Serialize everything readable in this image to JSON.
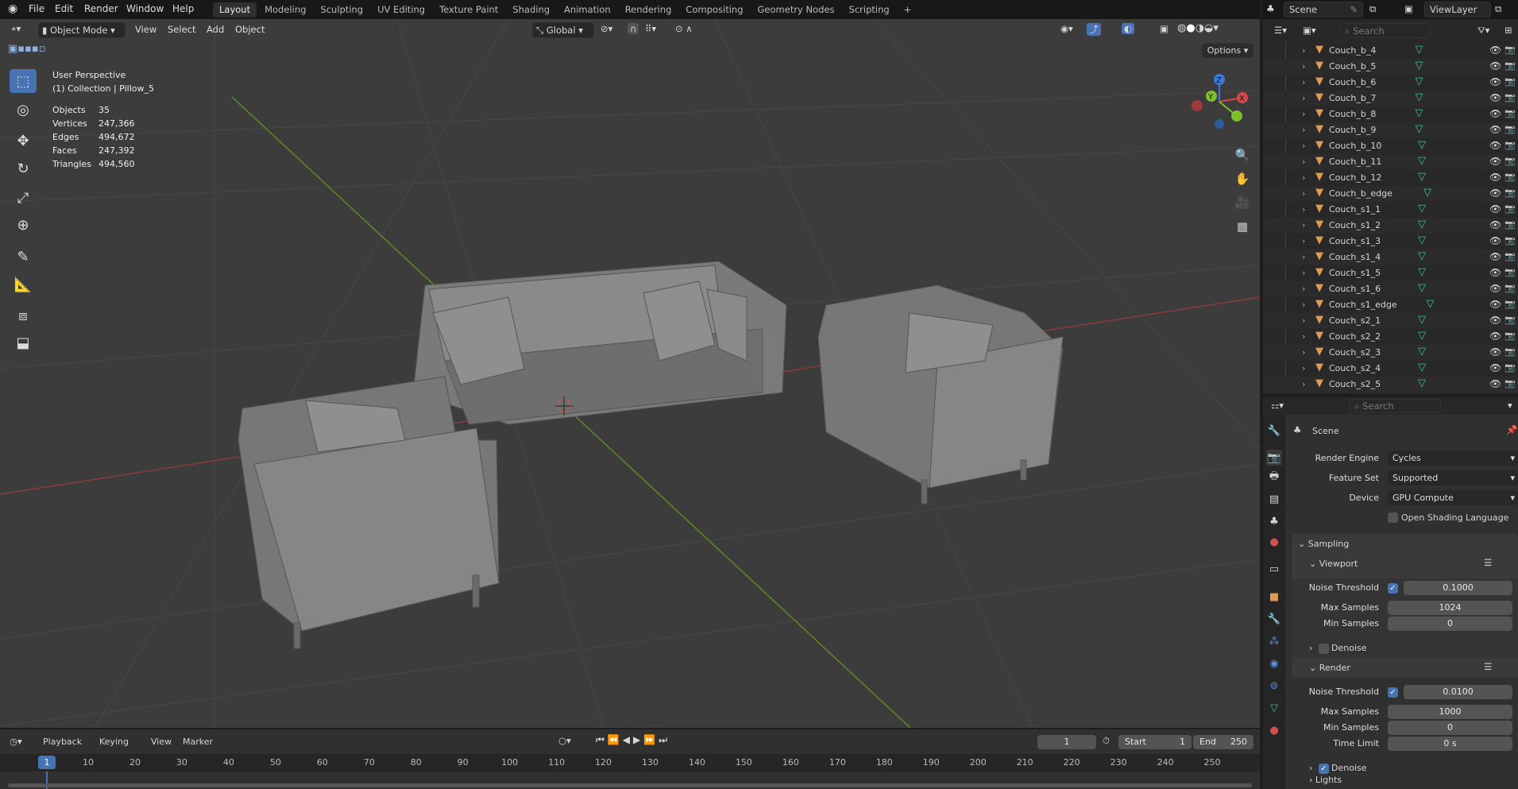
{
  "menu": [
    "File",
    "Edit",
    "Render",
    "Window",
    "Help"
  ],
  "workspaces": [
    "Layout",
    "Modeling",
    "Sculpting",
    "UV Editing",
    "Texture Paint",
    "Shading",
    "Animation",
    "Rendering",
    "Compositing",
    "Geometry Nodes",
    "Scripting",
    "+"
  ],
  "header": {
    "mode": "Object Mode",
    "menus": [
      "View",
      "Select",
      "Add",
      "Object"
    ],
    "transform_orientation": "Global",
    "options": "Options"
  },
  "overlay": {
    "perspective": "User Perspective",
    "collection": "(1) Collection | Pillow_5",
    "stats": [
      {
        "label": "Objects",
        "value": "35"
      },
      {
        "label": "Vertices",
        "value": "247,366"
      },
      {
        "label": "Edges",
        "value": "494,672"
      },
      {
        "label": "Faces",
        "value": "247,392"
      },
      {
        "label": "Triangles",
        "value": "494,560"
      }
    ]
  },
  "gizmo": {
    "x": "X",
    "y": "Y",
    "z": "Z"
  },
  "timeline": {
    "menus": [
      "Playback",
      "Keying",
      "View",
      "Marker"
    ],
    "current_frame": "1",
    "start_label": "Start",
    "start": "1",
    "end_label": "End",
    "end": "250",
    "ticks": [
      "10",
      "20",
      "30",
      "40",
      "50",
      "60",
      "70",
      "80",
      "90",
      "100",
      "110",
      "120",
      "130",
      "140",
      "150",
      "160",
      "170",
      "180",
      "190",
      "200",
      "210",
      "220",
      "230",
      "240",
      "250"
    ]
  },
  "topright": {
    "scene": "Scene",
    "view_layer": "ViewLayer"
  },
  "outliner": {
    "search_placeholder": "Search",
    "items": [
      "Couch_b_4",
      "Couch_b_5",
      "Couch_b_6",
      "Couch_b_7",
      "Couch_b_8",
      "Couch_b_9",
      "Couch_b_10",
      "Couch_b_11",
      "Couch_b_12",
      "Couch_b_edge",
      "Couch_s1_1",
      "Couch_s1_2",
      "Couch_s1_3",
      "Couch_s1_4",
      "Couch_s1_5",
      "Couch_s1_6",
      "Couch_s1_edge",
      "Couch_s2_1",
      "Couch_s2_2",
      "Couch_s2_3",
      "Couch_s2_4",
      "Couch_s2_5"
    ]
  },
  "properties": {
    "search_placeholder": "Search",
    "context": "Scene",
    "render_engine_label": "Render Engine",
    "render_engine": "Cycles",
    "feature_set_label": "Feature Set",
    "feature_set": "Supported",
    "device_label": "Device",
    "device": "GPU Compute",
    "osl": "Open Shading Language",
    "sampling": "Sampling",
    "viewport": "Viewport",
    "render": "Render",
    "noise_threshold": "Noise Threshold",
    "max_samples": "Max Samples",
    "min_samples": "Min Samples",
    "time_limit": "Time Limit",
    "denoise": "Denoise",
    "lights": "Lights",
    "vp_noise": "0.1000",
    "vp_max": "1024",
    "vp_min": "0",
    "r_noise": "0.0100",
    "r_max": "1000",
    "r_min": "0",
    "r_time": "0 s"
  },
  "colors": {
    "accent": "#4772b3",
    "object_orange": "#e09a54",
    "mesh_green": "#3fc1a0",
    "x_axis": "#b03a3a",
    "y_axis": "#6a8f2a"
  }
}
